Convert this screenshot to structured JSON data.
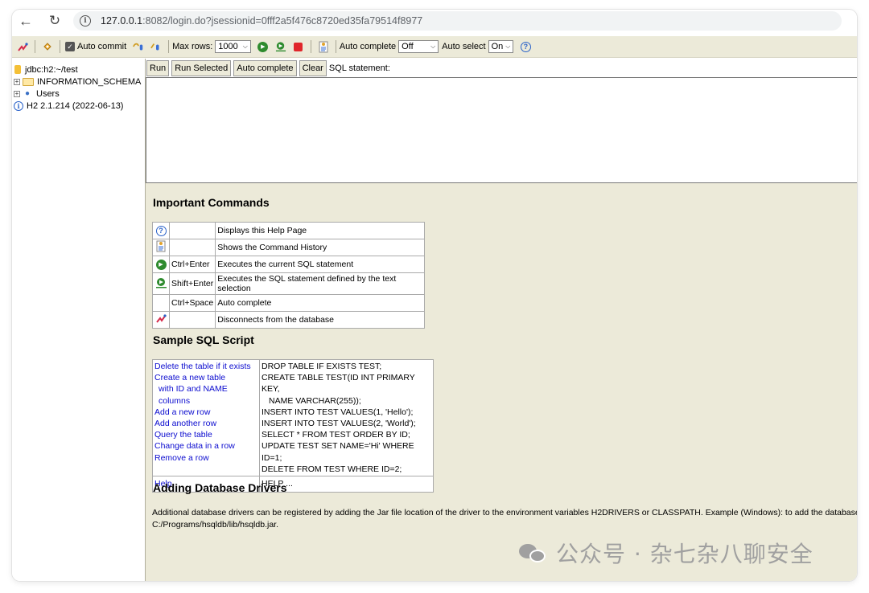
{
  "browser": {
    "url_host": "127.0.0.1",
    "url_path": ":8082/login.do?jsessionid=0fff2a5f476c8720ed35fa79514f8977"
  },
  "toolbar": {
    "auto_commit_label": "Auto commit",
    "max_rows_label": "Max rows:",
    "max_rows_value": "1000",
    "auto_complete_label": "Auto complete",
    "auto_complete_value": "Off",
    "auto_select_label": "Auto select",
    "auto_select_value": "On"
  },
  "tree": {
    "connection": "jdbc:h2:~/test",
    "schema": "INFORMATION_SCHEMA",
    "users": "Users",
    "version": "H2 2.1.214 (2022-06-13)"
  },
  "sql": {
    "run": "Run",
    "run_selected": "Run Selected",
    "auto_complete": "Auto complete",
    "clear": "Clear",
    "statement_label": "SQL statement:"
  },
  "help": {
    "important_title": "Important Commands",
    "commands": [
      {
        "icon": "help-icon",
        "key": "",
        "desc": "Displays this Help Page"
      },
      {
        "icon": "history-icon",
        "key": "",
        "desc": "Shows the Command History"
      },
      {
        "icon": "run-icon",
        "key": "Ctrl+Enter",
        "desc": "Executes the current SQL statement"
      },
      {
        "icon": "run-selected-icon",
        "key": "Shift+Enter",
        "desc": "Executes the SQL statement defined by the text selection"
      },
      {
        "icon": "",
        "key": "Ctrl+Space",
        "desc": "Auto complete"
      },
      {
        "icon": "disconnect-icon",
        "key": "",
        "desc": "Disconnects from the database"
      }
    ],
    "sample_title": "Sample SQL Script",
    "sample": {
      "l1": "Delete the table if it exists",
      "l2": "Create a new table",
      "l3": "with ID and NAME columns",
      "l4": "Add a new row",
      "l5": "Add another row",
      "l6": "Query the table",
      "l7": "Change data in a row",
      "l8": "Remove a row",
      "s1": "DROP TABLE IF EXISTS TEST;",
      "s2": "CREATE TABLE TEST(ID INT PRIMARY KEY,",
      "s3": "NAME VARCHAR(255));",
      "s4": "INSERT INTO TEST VALUES(1, 'Hello');",
      "s5": "INSERT INTO TEST VALUES(2, 'World');",
      "s6": "SELECT * FROM TEST ORDER BY ID;",
      "s7": "UPDATE TEST SET NAME='Hi' WHERE ID=1;",
      "s8": "DELETE FROM TEST WHERE ID=2;",
      "help_link": "Help",
      "help_sql": "HELP ..."
    },
    "drivers_title": "Adding Database Drivers",
    "drivers_line1": "Additional database drivers can be registered by adding the Jar file location of the driver to the environment variables H2DRIVERS or CLASSPATH. Example (Windows): to add the database drive",
    "drivers_line2": "C:/Programs/hsqldb/lib/hsqldb.jar."
  },
  "watermark": "公众号 · 杂七杂八聊安全"
}
